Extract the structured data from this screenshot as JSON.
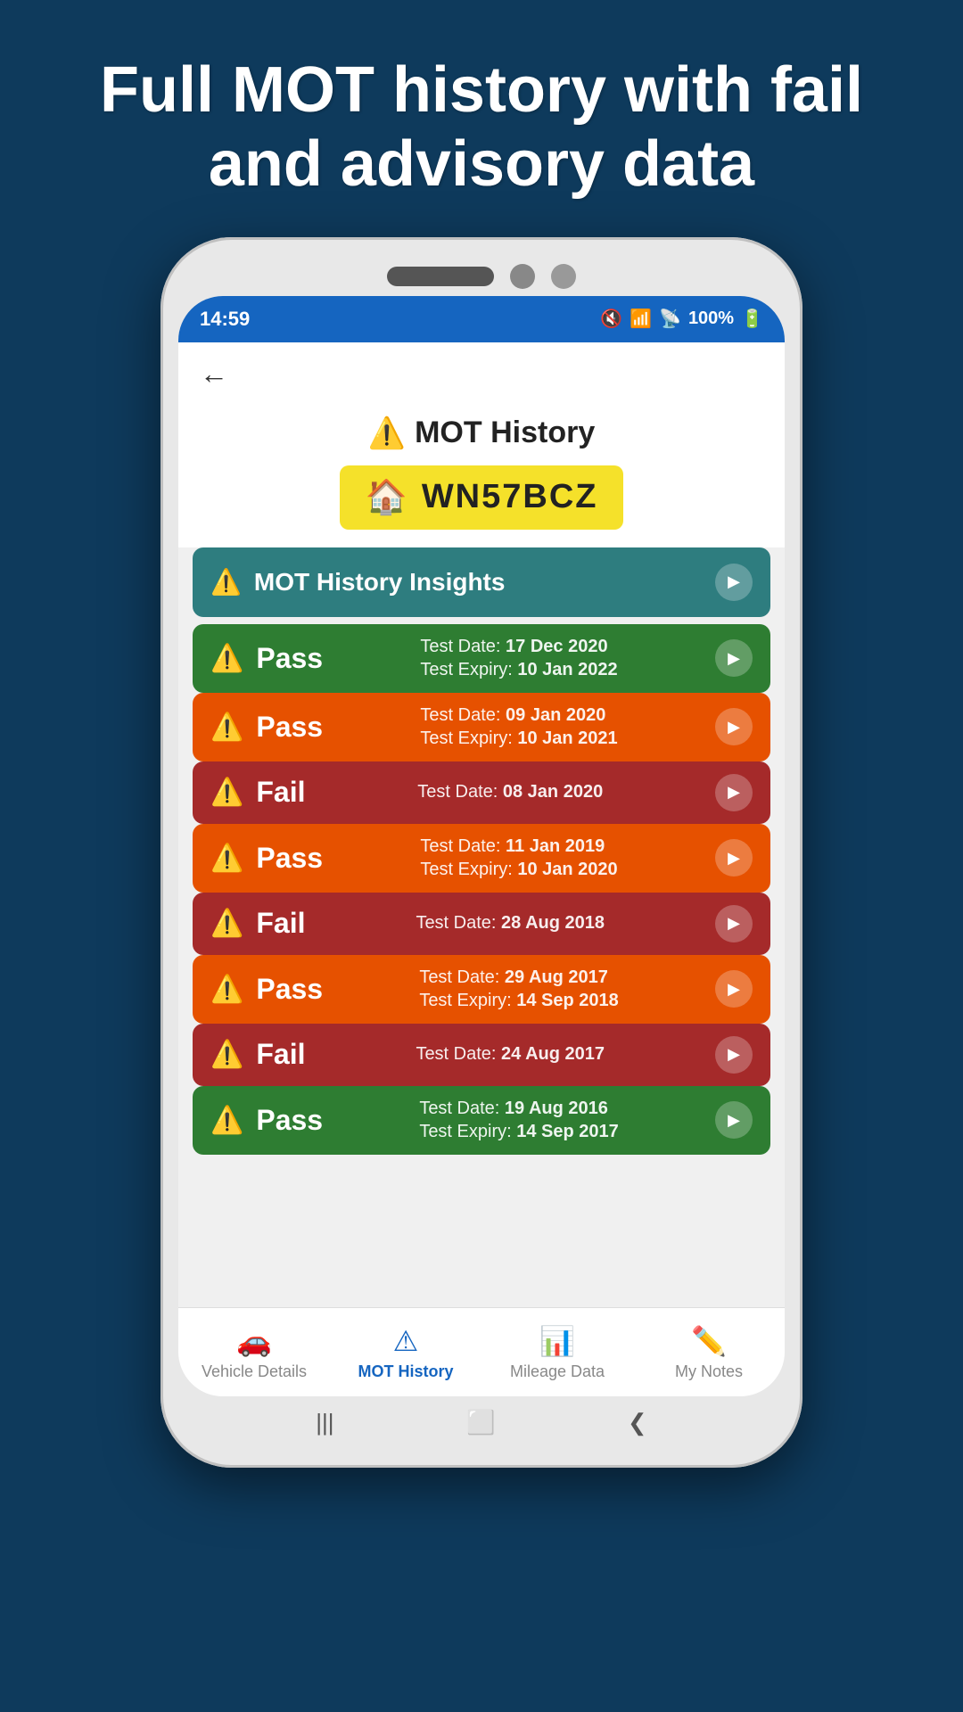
{
  "hero": {
    "text": "Full MOT history with fail and advisory data"
  },
  "status_bar": {
    "time": "14:59",
    "battery": "100%",
    "signal": "📶",
    "wifi": "WiFi"
  },
  "app_header": {
    "back": "←"
  },
  "mot_page": {
    "title": "MOT History",
    "plate": "WN57BCZ",
    "insights_label": "MOT History Insights"
  },
  "mot_records": [
    {
      "status": "Pass",
      "color": "green",
      "test_date_label": "Test Date:",
      "test_date_value": "17 Dec 2020",
      "expiry_label": "Test Expiry:",
      "expiry_value": "10 Jan 2022",
      "has_expiry": true
    },
    {
      "status": "Pass",
      "color": "orange",
      "test_date_label": "Test Date:",
      "test_date_value": "09 Jan 2020",
      "expiry_label": "Test Expiry:",
      "expiry_value": "10 Jan 2021",
      "has_expiry": true
    },
    {
      "status": "Fail",
      "color": "red",
      "test_date_label": "Test Date:",
      "test_date_value": "08 Jan 2020",
      "expiry_label": "",
      "expiry_value": "",
      "has_expiry": false
    },
    {
      "status": "Pass",
      "color": "orange",
      "test_date_label": "Test Date:",
      "test_date_value": "11 Jan 2019",
      "expiry_label": "Test Expiry:",
      "expiry_value": "10 Jan 2020",
      "has_expiry": true
    },
    {
      "status": "Fail",
      "color": "red",
      "test_date_label": "Test Date:",
      "test_date_value": "28 Aug 2018",
      "expiry_label": "",
      "expiry_value": "",
      "has_expiry": false
    },
    {
      "status": "Pass",
      "color": "orange",
      "test_date_label": "Test Date:",
      "test_date_value": "29 Aug 2017",
      "expiry_label": "Test Expiry:",
      "expiry_value": "14 Sep 2018",
      "has_expiry": true
    },
    {
      "status": "Fail",
      "color": "red",
      "test_date_label": "Test Date:",
      "test_date_value": "24 Aug 2017",
      "expiry_label": "",
      "expiry_value": "",
      "has_expiry": false
    },
    {
      "status": "Pass",
      "color": "green",
      "test_date_label": "Test Date:",
      "test_date_value": "19 Aug 2016",
      "expiry_label": "Test Expiry:",
      "expiry_value": "14 Sep 2017",
      "has_expiry": true
    }
  ],
  "bottom_nav": {
    "items": [
      {
        "label": "Vehicle Details",
        "icon": "🚗",
        "active": false
      },
      {
        "label": "MOT History",
        "icon": "⚠",
        "active": true
      },
      {
        "label": "Mileage Data",
        "icon": "📊",
        "active": false
      },
      {
        "label": "My Notes",
        "icon": "✏️",
        "active": false
      }
    ]
  },
  "phone_nav": {
    "back": "❮",
    "home": "⬜",
    "recents": "❙❙❙"
  }
}
